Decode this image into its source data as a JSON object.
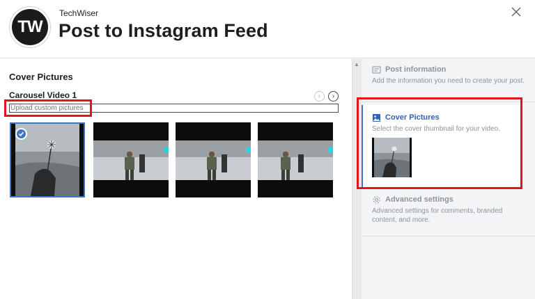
{
  "header": {
    "logo_text": "TW",
    "brand": "TechWiser",
    "title": "Post to Instagram Feed",
    "close_icon": "close-icon"
  },
  "main": {
    "section_title": "Cover Pictures",
    "carousel_label": "Carousel Video 1",
    "upload_placeholder": "Upload custom pictures",
    "nav_prev_icon": "chevron-left-icon",
    "nav_next_icon": "chevron-right-icon",
    "thumbnails": [
      {
        "kind": "portrait",
        "selected": true
      },
      {
        "kind": "landscape",
        "selected": false
      },
      {
        "kind": "landscape",
        "selected": false
      },
      {
        "kind": "landscape",
        "selected": false
      }
    ]
  },
  "sidebar": {
    "steps": [
      {
        "icon": "post-info-icon",
        "title": "Post information",
        "desc": "Add the information you need to create your post."
      },
      {
        "icon": "image-icon",
        "title": "Cover Pictures",
        "desc": "Select the cover thumbnail for your video."
      },
      {
        "icon": "gear-icon",
        "title": "Advanced settings",
        "desc": "Advanced settings for comments, branded content, and more."
      }
    ]
  },
  "colors": {
    "accent": "#3f73c5",
    "annotation_red": "#e0161f",
    "sidebar_bg": "#f3f4f6"
  }
}
